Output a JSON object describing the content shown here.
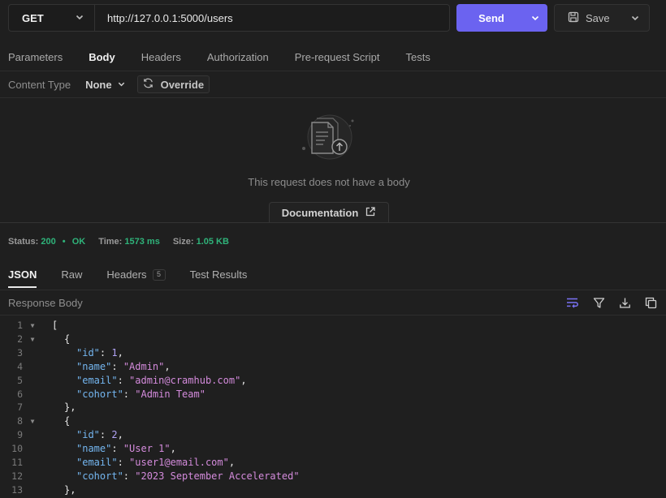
{
  "request": {
    "method": "GET",
    "url": "http://127.0.0.1:5000/users",
    "send_label": "Send",
    "save_label": "Save"
  },
  "request_tabs": [
    "Parameters",
    "Body",
    "Headers",
    "Authorization",
    "Pre-request Script",
    "Tests"
  ],
  "active_request_tab": "Body",
  "body": {
    "content_type_label": "Content Type",
    "content_type_value": "None",
    "override_label": "Override",
    "empty_message": "This request does not have a body",
    "documentation_label": "Documentation"
  },
  "status": {
    "status_label": "Status:",
    "status_code": "200",
    "status_text": "OK",
    "time_label": "Time:",
    "time_value": "1573 ms",
    "size_label": "Size:",
    "size_value": "1.05 KB"
  },
  "response_tabs": [
    {
      "label": "JSON"
    },
    {
      "label": "Raw"
    },
    {
      "label": "Headers",
      "badge": "5"
    },
    {
      "label": "Test Results"
    }
  ],
  "response_body_title": "Response Body",
  "response_actions": [
    "wrap-lines-icon",
    "filter-icon",
    "download-icon",
    "copy-icon"
  ],
  "json_lines": [
    {
      "n": "1",
      "fold": true,
      "indent": 0,
      "tokens": [
        [
          "p",
          "["
        ]
      ]
    },
    {
      "n": "2",
      "fold": true,
      "indent": 1,
      "tokens": [
        [
          "p",
          "{"
        ]
      ]
    },
    {
      "n": "3",
      "fold": false,
      "indent": 2,
      "tokens": [
        [
          "k",
          "\"id\""
        ],
        [
          "p",
          ": "
        ],
        [
          "n",
          "1"
        ],
        [
          "p",
          ","
        ]
      ]
    },
    {
      "n": "4",
      "fold": false,
      "indent": 2,
      "tokens": [
        [
          "k",
          "\"name\""
        ],
        [
          "p",
          ": "
        ],
        [
          "s",
          "\"Admin\""
        ],
        [
          "p",
          ","
        ]
      ]
    },
    {
      "n": "5",
      "fold": false,
      "indent": 2,
      "tokens": [
        [
          "k",
          "\"email\""
        ],
        [
          "p",
          ": "
        ],
        [
          "s",
          "\"admin@cramhub.com\""
        ],
        [
          "p",
          ","
        ]
      ]
    },
    {
      "n": "6",
      "fold": false,
      "indent": 2,
      "tokens": [
        [
          "k",
          "\"cohort\""
        ],
        [
          "p",
          ": "
        ],
        [
          "s",
          "\"Admin Team\""
        ]
      ]
    },
    {
      "n": "7",
      "fold": false,
      "indent": 1,
      "tokens": [
        [
          "p",
          "},"
        ]
      ]
    },
    {
      "n": "8",
      "fold": true,
      "indent": 1,
      "tokens": [
        [
          "p",
          "{"
        ]
      ]
    },
    {
      "n": "9",
      "fold": false,
      "indent": 2,
      "tokens": [
        [
          "k",
          "\"id\""
        ],
        [
          "p",
          ": "
        ],
        [
          "n",
          "2"
        ],
        [
          "p",
          ","
        ]
      ]
    },
    {
      "n": "10",
      "fold": false,
      "indent": 2,
      "tokens": [
        [
          "k",
          "\"name\""
        ],
        [
          "p",
          ": "
        ],
        [
          "s",
          "\"User 1\""
        ],
        [
          "p",
          ","
        ]
      ]
    },
    {
      "n": "11",
      "fold": false,
      "indent": 2,
      "tokens": [
        [
          "k",
          "\"email\""
        ],
        [
          "p",
          ": "
        ],
        [
          "s",
          "\"user1@email.com\""
        ],
        [
          "p",
          ","
        ]
      ]
    },
    {
      "n": "12",
      "fold": false,
      "indent": 2,
      "tokens": [
        [
          "k",
          "\"cohort\""
        ],
        [
          "p",
          ": "
        ],
        [
          "s",
          "\"2023 September Accelerated\""
        ]
      ]
    },
    {
      "n": "13",
      "fold": false,
      "indent": 1,
      "tokens": [
        [
          "p",
          "},"
        ]
      ]
    }
  ],
  "colors": {
    "accent": "#6b63f0",
    "success": "#2fb37a",
    "json_key": "#74b6f0",
    "json_string": "#d48bdc",
    "json_number": "#b1a3f5"
  }
}
